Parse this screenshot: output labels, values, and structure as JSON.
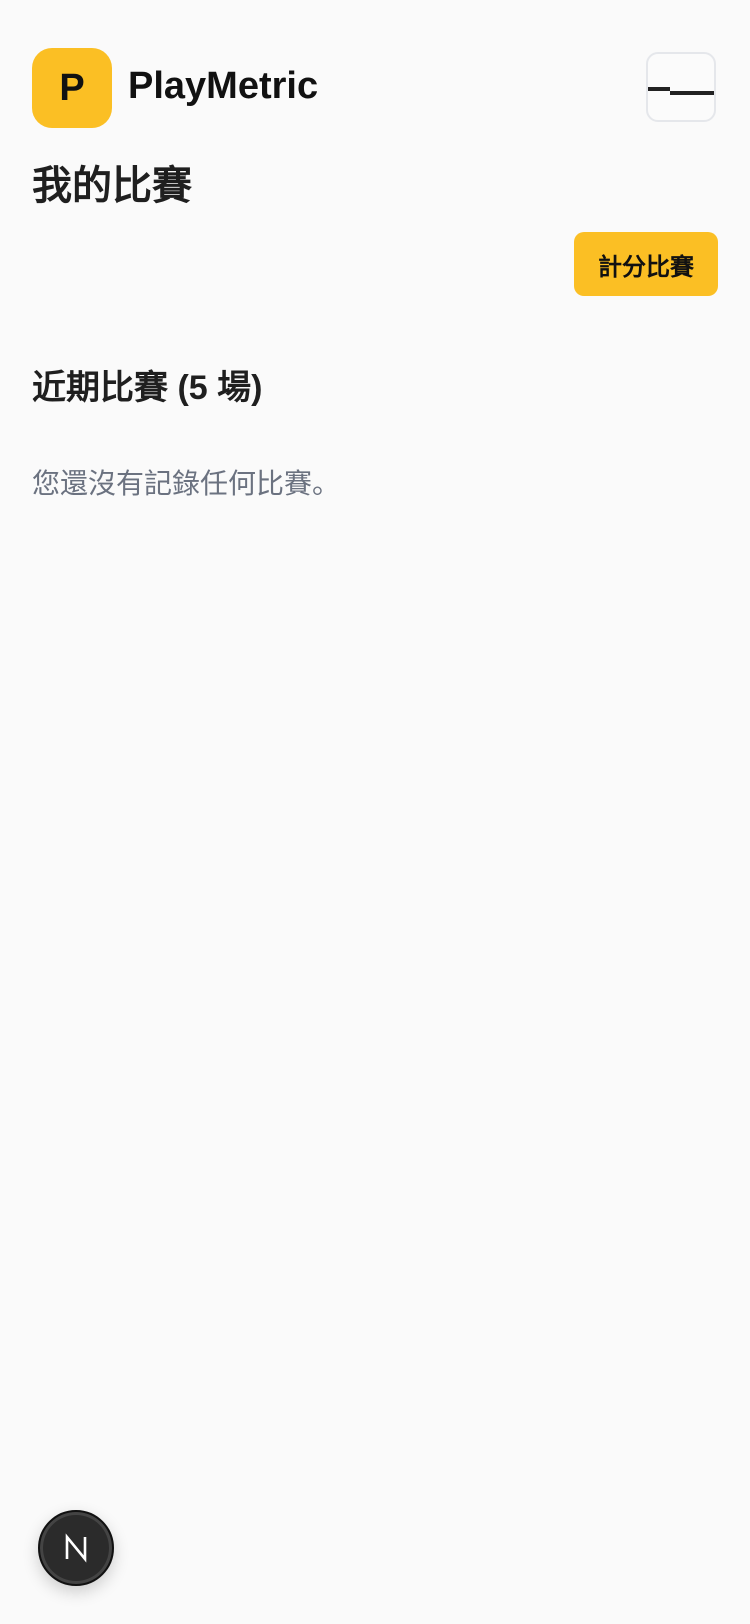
{
  "header": {
    "logo_letter": "P",
    "brand_name": "PlayMetric"
  },
  "main": {
    "page_title": "我的比賽",
    "score_button_label": "計分比賽",
    "section_title": "近期比賽 (5 場)",
    "empty_message": "您還沒有記錄任何比賽。"
  },
  "floating": {
    "fab_letter": "N",
    "icon": "nextjs-logo-icon"
  },
  "colors": {
    "accent": "#fbbf24",
    "background": "#fafafa",
    "muted_text": "#6b7280"
  }
}
